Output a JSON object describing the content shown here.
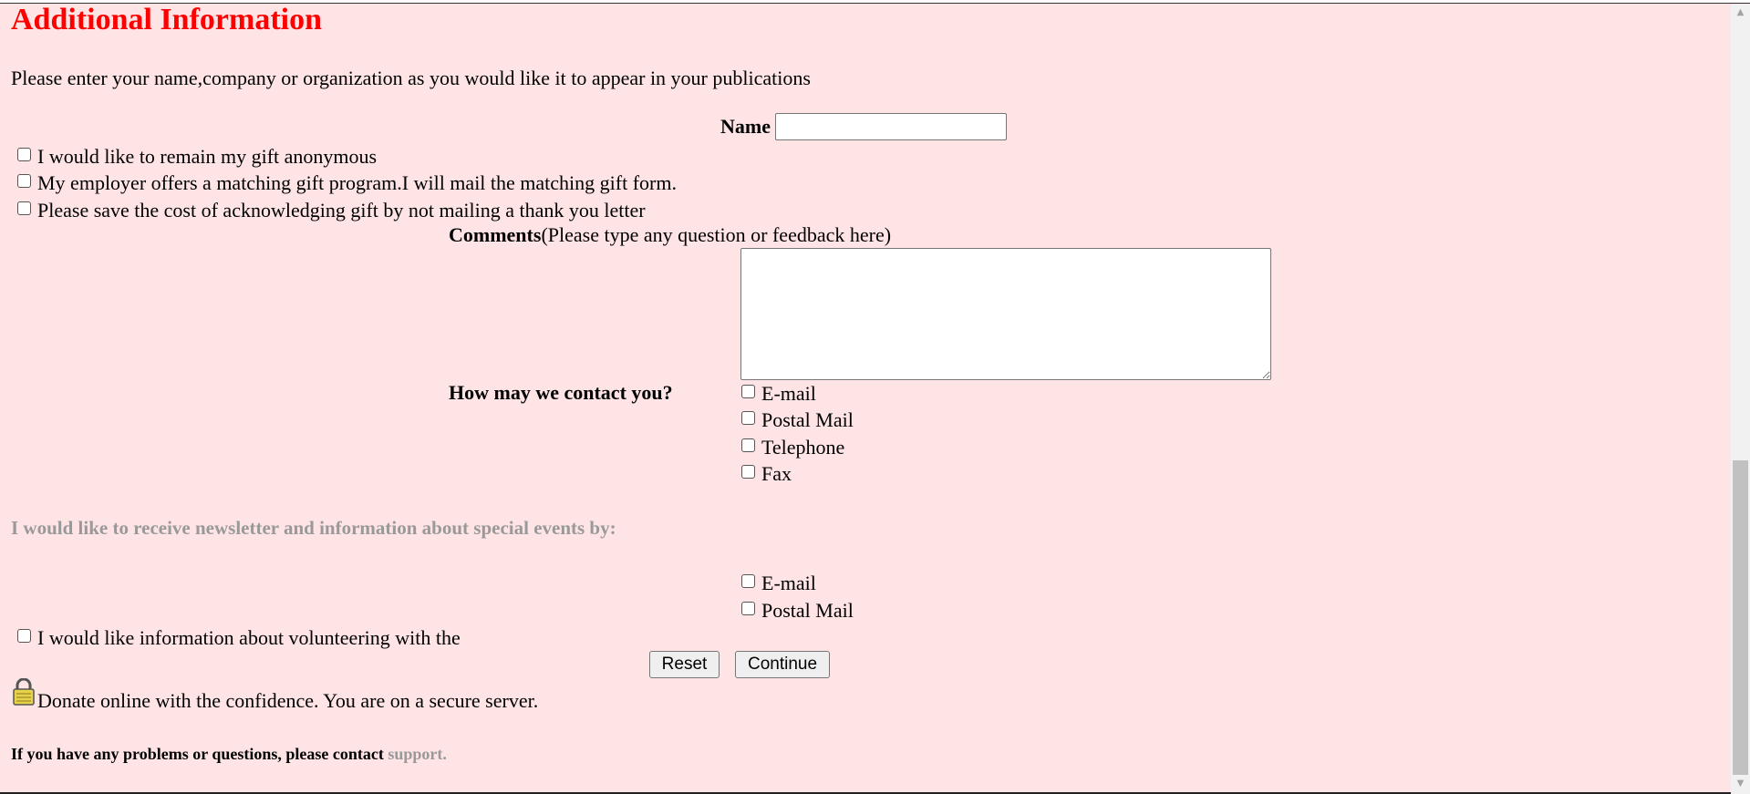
{
  "section_title": "Additional Information",
  "intro_text": "Please enter your name,company or organization as you would like it to appear in your publications",
  "name_label": "Name",
  "name_value": "",
  "options": {
    "anonymous": "I would like to remain my gift anonymous",
    "matching": "My employer offers a matching gift program.I will mail the matching gift form.",
    "no_thanks_letter": "Please save the cost of acknowledging gift by not mailing a thank you letter"
  },
  "comments": {
    "label": "Comments",
    "hint": "(Please type any question or feedback here)",
    "value": ""
  },
  "contact": {
    "label": "How may we contact you?",
    "options": [
      "E-mail",
      "Postal Mail",
      "Telephone",
      "Fax"
    ]
  },
  "newsletter": {
    "heading": "I would like to receive newsletter and information about special events by:",
    "options": [
      "E-mail",
      "Postal Mail"
    ]
  },
  "volunteer_label": "I would like information about volunteering with the",
  "buttons": {
    "reset": "Reset",
    "continue": "Continue"
  },
  "secure_text": "Donate online with the confidence. You are on a secure server.",
  "support": {
    "text": "If you have any problems or questions, please contact",
    "link": "support."
  },
  "colors": {
    "background": "#ffe4e6",
    "title": "#ff0000",
    "muted": "#999999"
  },
  "icons": [
    "padlock-icon",
    "scroll-up-icon",
    "scroll-down-icon"
  ]
}
